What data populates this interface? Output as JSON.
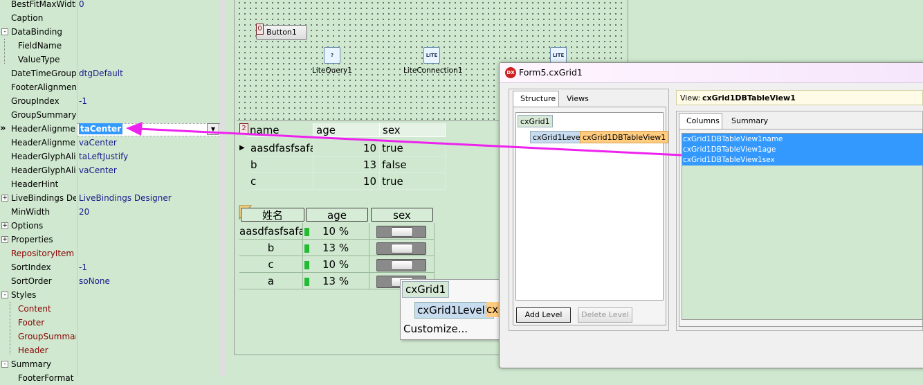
{
  "inspector": {
    "rows": [
      {
        "name": "BestFitMaxWidth",
        "value": "0"
      },
      {
        "name": "Caption",
        "value": ""
      },
      {
        "name": "DataBinding",
        "value": "",
        "expander": "-"
      },
      {
        "name": "FieldName",
        "value": ""
      },
      {
        "name": "ValueType",
        "value": ""
      },
      {
        "name": "DateTimeGroupin",
        "value": "dtgDefault"
      },
      {
        "name": "FooterAlignmentH",
        "value": ""
      },
      {
        "name": "GroupIndex",
        "value": "-1"
      },
      {
        "name": "GroupSummaryAl",
        "value": ""
      },
      {
        "name": "HeaderAlignment",
        "value": "taCenter"
      },
      {
        "name": "HeaderAlignment",
        "value": "vaCenter"
      },
      {
        "name": "HeaderGlyphAlign",
        "value": "taLeftJustify"
      },
      {
        "name": "HeaderGlyphAlign",
        "value": "vaCenter"
      },
      {
        "name": "HeaderHint",
        "value": ""
      },
      {
        "name": "LiveBindings Desig",
        "value": "LiveBindings Designer",
        "expander": "+"
      },
      {
        "name": "MinWidth",
        "value": "20"
      },
      {
        "name": "Options",
        "value": "",
        "expander": "+"
      },
      {
        "name": "Properties",
        "value": "",
        "expander": "+"
      },
      {
        "name": "RepositoryItem",
        "value": ""
      },
      {
        "name": "SortIndex",
        "value": "-1"
      },
      {
        "name": "SortOrder",
        "value": "soNone"
      },
      {
        "name": "Styles",
        "value": "",
        "expander": "-"
      },
      {
        "name": "Content",
        "value": ""
      },
      {
        "name": "Footer",
        "value": ""
      },
      {
        "name": "GroupSummary",
        "value": ""
      },
      {
        "name": "Header",
        "value": ""
      },
      {
        "name": "Summary",
        "value": "",
        "expander": "-"
      },
      {
        "name": "FooterFormat",
        "value": ""
      }
    ],
    "selected_marker": "»",
    "dropdown_glyph": "▼"
  },
  "form": {
    "button1_label": "Button1",
    "button1_badge": "0",
    "components": [
      {
        "label": "LiteQuery1",
        "icon_text": "?"
      },
      {
        "label": "LiteConnection1",
        "icon_text": "LITE"
      },
      {
        "label": "",
        "icon_text": "LITE"
      }
    ]
  },
  "dbgrid": {
    "badge": "2",
    "columns": [
      "name",
      "age",
      "sex"
    ],
    "indicator": "▶",
    "rows": [
      [
        "aasdfasfsafas",
        "10",
        "true"
      ],
      [
        "b",
        "13",
        "false"
      ],
      [
        "c",
        "10",
        "true"
      ]
    ]
  },
  "cxgrid": {
    "columns": [
      "姓名",
      "age",
      "sex"
    ],
    "rows": [
      {
        "name": "aasdfasfsafa",
        "age": "10 %",
        "pct": 10
      },
      {
        "name": "b",
        "age": "13 %",
        "pct": 13
      },
      {
        "name": "c",
        "age": "10 %",
        "pct": 10
      },
      {
        "name": "a",
        "age": "13 %",
        "pct": 13
      }
    ]
  },
  "popup": {
    "title": "cxGrid1",
    "level": "cxGrid1Level1",
    "view_fragment": "cx",
    "customize": "Customize..."
  },
  "dialog": {
    "title": "Form5.cxGrid1",
    "icon_text": "DX",
    "tabs": [
      "Structure",
      "Views"
    ],
    "tree_root": "cxGrid1",
    "tree_level": "cxGrid1Level1",
    "tree_view": "cxGrid1DBTableView1",
    "add_level": "Add Level",
    "delete_level": "Delete Level",
    "view_caption": "View:",
    "view_name": "cxGrid1DBTableView1",
    "right_tabs": [
      "Columns",
      "Summary"
    ],
    "column_items": [
      "cxGrid1DBTableView1name",
      "cxGrid1DBTableView1age",
      "cxGrid1DBTableView1sex"
    ]
  },
  "colors": {
    "background": "#cfe8cf",
    "selection": "#3399ff",
    "annotation_arrow": "#ee22ee",
    "view_highlight": "#ffcc80"
  }
}
